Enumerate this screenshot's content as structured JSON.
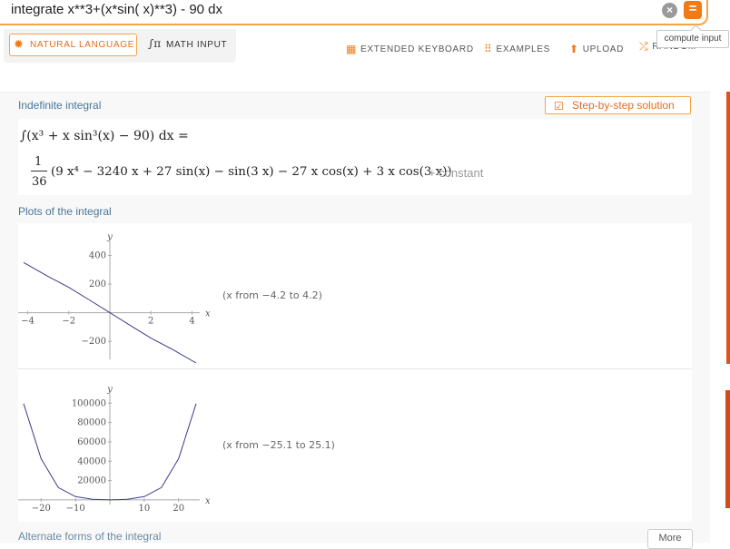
{
  "search": {
    "query": "integrate x**3+(x*sin( x)**3) - 90 dx",
    "clear_icon": "close-icon",
    "compute_icon": "equals-icon"
  },
  "tooltip": "compute input",
  "modes": {
    "natural_language": "NATURAL LANGUAGE",
    "math_input": "MATH INPUT"
  },
  "toolbar": {
    "extended_keyboard": "EXTENDED KEYBOARD",
    "examples": "EXAMPLES",
    "upload": "UPLOAD",
    "random": "RANDOM"
  },
  "pods": {
    "indefinite": {
      "title": "Indefinite integral",
      "step_button": "Step-by-step solution",
      "line1": "∫(x³ + x sin³(x) − 90) dx =",
      "numerator": "1",
      "denominator": "36",
      "line2": "(9 x⁴ − 3240 x + 27 sin(x) − sin(3 x) − 27 x cos(x) + 3 x cos(3 x))",
      "constant": "+ constant"
    },
    "plots": {
      "title": "Plots of the integral",
      "plot1_range": "(x from −4.2 to 4.2)",
      "plot2_range": "(x from −25.1 to 25.1)"
    },
    "alternate": {
      "title": "Alternate forms of the integral",
      "more": "More"
    }
  },
  "chart_data": [
    {
      "type": "line",
      "x": [
        -4.2,
        -3,
        -2,
        -1,
        0,
        1,
        2,
        3,
        4.2
      ],
      "y": [
        350.6,
        252.6,
        176.9,
        89.3,
        0,
        -89.3,
        -176.9,
        -252.6,
        -350.6
      ],
      "xlabel": "x",
      "ylabel": "y",
      "xticks": [
        -4,
        -2,
        2,
        4
      ],
      "yticks": [
        400,
        200,
        -200
      ],
      "xlim": [
        -4.2,
        4.2
      ],
      "ylim": [
        -300,
        460
      ]
    },
    {
      "type": "line",
      "x": [
        -25.1,
        -20,
        -15,
        -10,
        -5,
        0,
        5,
        10,
        15,
        20,
        25.1
      ],
      "y": [
        99500,
        42600,
        12800,
        3400,
        600,
        0,
        600,
        3400,
        12800,
        42600,
        99500
      ],
      "xlabel": "x",
      "ylabel": "y",
      "xticks": [
        -20,
        -10,
        10,
        20
      ],
      "yticks": [
        100000,
        80000,
        60000,
        40000,
        20000
      ],
      "xlim": [
        -25.1,
        25.1
      ],
      "ylim": [
        -1000,
        104000
      ]
    }
  ]
}
